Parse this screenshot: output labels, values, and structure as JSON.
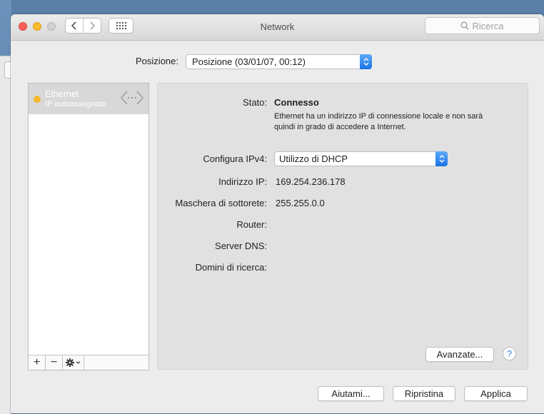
{
  "window": {
    "title": "Network",
    "search_placeholder": "Ricerca",
    "search_icon": "magnifier-icon",
    "back_icon": "chevron-left-icon",
    "forward_icon": "chevron-right-icon",
    "grid_icon": "show-all-grid-icon"
  },
  "location": {
    "label": "Posizione:",
    "value": "Posizione (03/01/07, 00:12)"
  },
  "services": [
    {
      "name": "Ethernet",
      "subtitle": "IP autoassegnato",
      "status_color": "#f5b82e",
      "icon": "ethernet-arrows-icon"
    }
  ],
  "sidebar_toolbar": {
    "add": "+",
    "remove": "−",
    "action_icon": "gear-menu-icon"
  },
  "detail": {
    "status_label": "Stato:",
    "status_value": "Connesso",
    "status_description": "Ethernet ha un indirizzo IP di connessione locale e non sarà quindi in grado di accedere a Internet.",
    "configure_label": "Configura IPv4:",
    "configure_value": "Utilizzo di DHCP",
    "ip_label": "Indirizzo IP:",
    "ip_value": "169.254.236.178",
    "mask_label": "Maschera di sottorete:",
    "mask_value": "255.255.0.0",
    "router_label": "Router:",
    "dns_label": "Server DNS:",
    "search_domains_label": "Domini di ricerca:",
    "advanced_button": "Avanzate...",
    "help_button": "?"
  },
  "footer": {
    "help_button": "Aiutami...",
    "revert_button": "Ripristina",
    "apply_button": "Applica"
  },
  "colors": {
    "accent": "#1a74e6",
    "status_pending": "#f5b82e"
  }
}
